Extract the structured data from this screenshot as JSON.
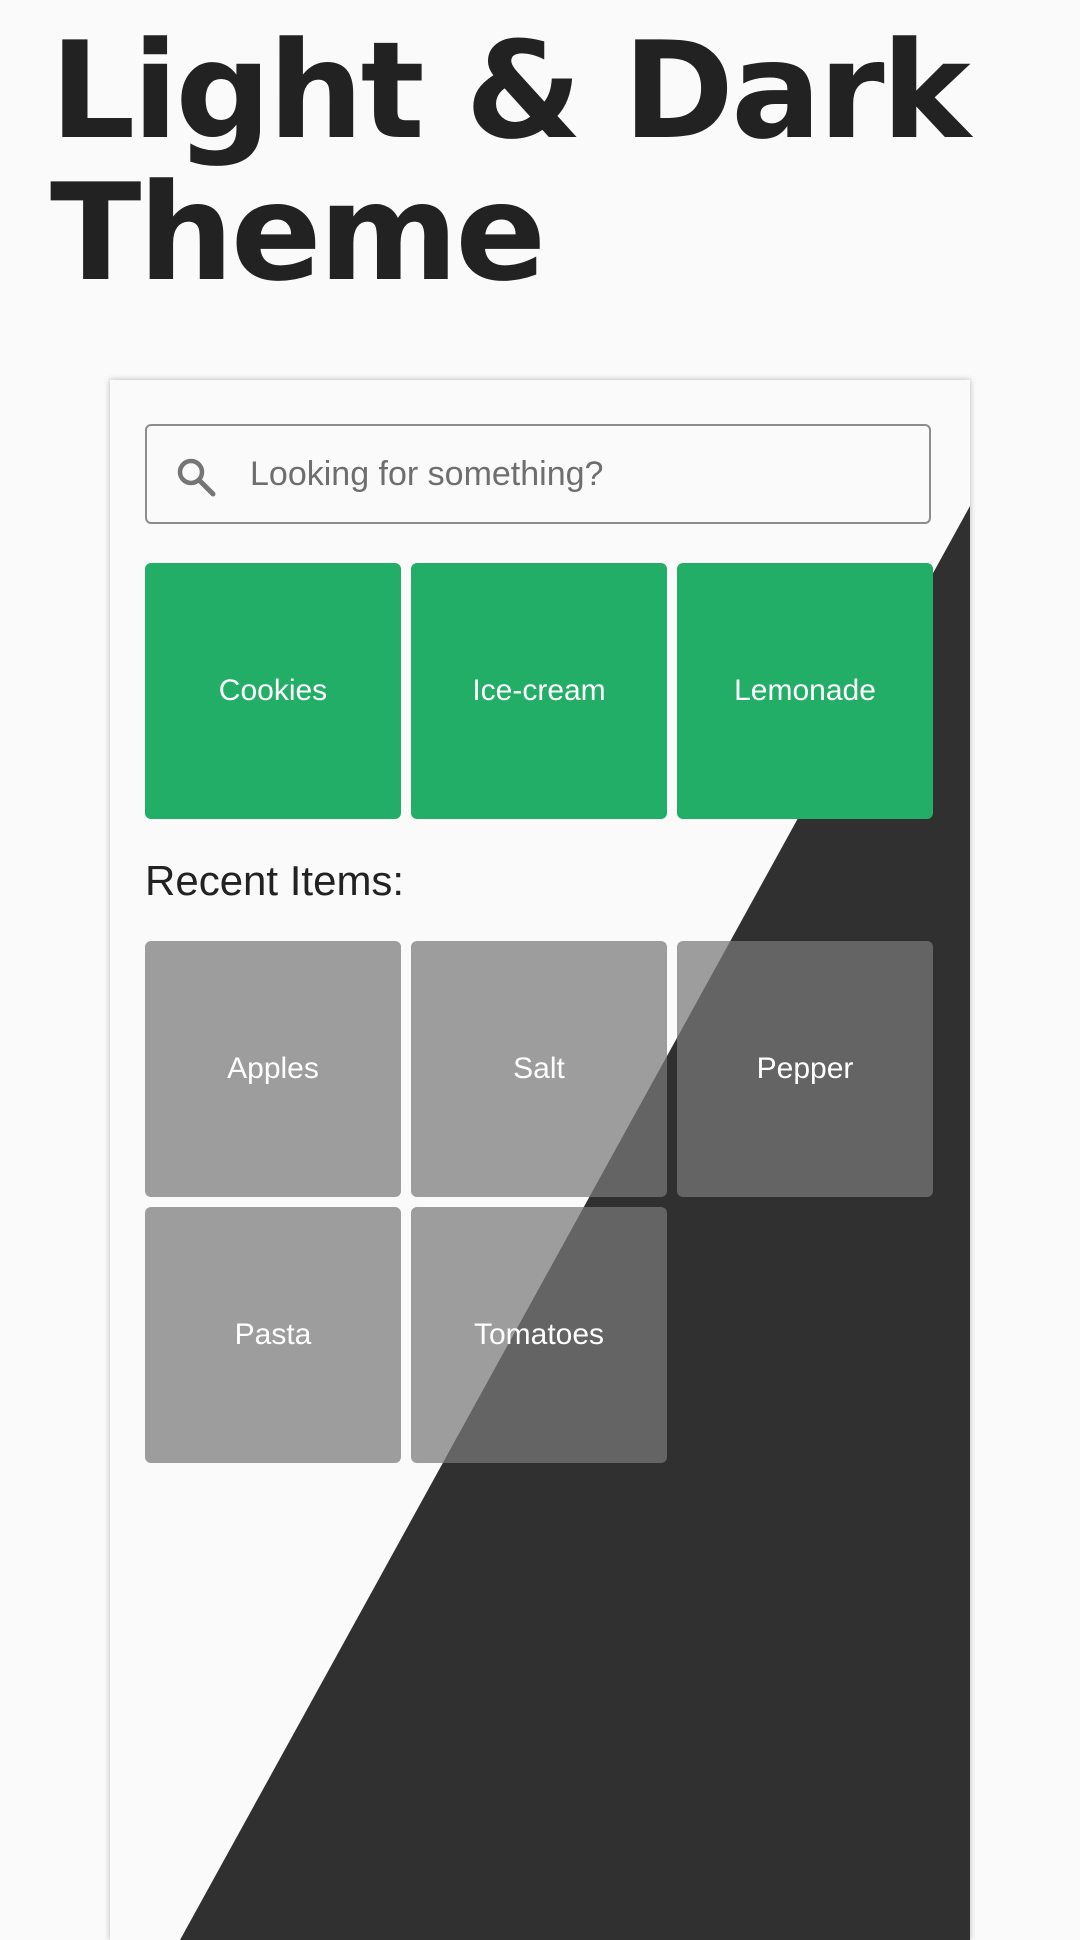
{
  "page": {
    "title_line1": "Light & Dark",
    "title_line2": "Theme"
  },
  "search": {
    "icon": "search-icon",
    "placeholder": "Looking for something?"
  },
  "categories": [
    {
      "label": "Cookies"
    },
    {
      "label": "Ice-cream"
    },
    {
      "label": "Lemonade"
    }
  ],
  "recent": {
    "heading": "Recent Items:",
    "items": [
      {
        "label": "Apples"
      },
      {
        "label": "Salt"
      },
      {
        "label": "Pepper"
      },
      {
        "label": "Pasta"
      },
      {
        "label": "Tomatoes"
      }
    ]
  },
  "theme": {
    "light_background": "#fafafa",
    "dark_background": "#303030",
    "accent": "#23ae67",
    "tile_grey": "#9a9a9a",
    "text_dark": "#222222"
  }
}
